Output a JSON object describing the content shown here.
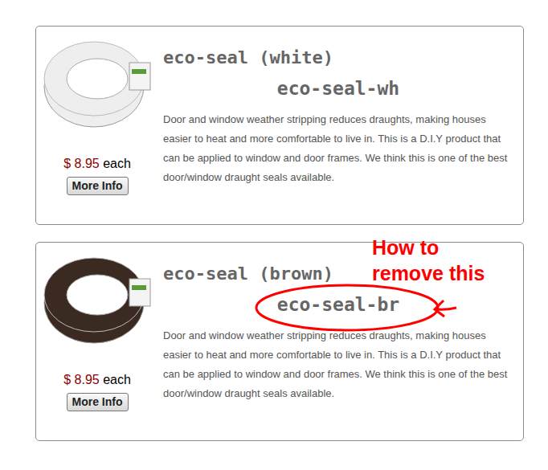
{
  "products": [
    {
      "title": "eco-seal (white)",
      "code": "eco-seal-wh",
      "description": "Door and window weather stripping reduces draughts, making houses easier to heat and more comfortable to live in. This is a D.I.Y product that can be applied to window and door frames.  We think this is one of the best door/window draught seals available.",
      "currency": "$",
      "price": "8.95",
      "unit": "each",
      "button": "More Info",
      "color": "#eeeeee"
    },
    {
      "title": "eco-seal (brown)",
      "code": "eco-seal-br",
      "description": "Door and window weather stripping reduces draughts, making houses easier to heat and more comfortable to live in. This is a D.I.Y product that can be applied to window and door frames.  We think this is one of the best door/window draught seals available.",
      "currency": "$",
      "price": "8.95",
      "unit": "each",
      "button": "More Info",
      "color": "#3a2a22"
    }
  ],
  "annotation": {
    "lines": [
      "How to",
      "remove this"
    ]
  }
}
